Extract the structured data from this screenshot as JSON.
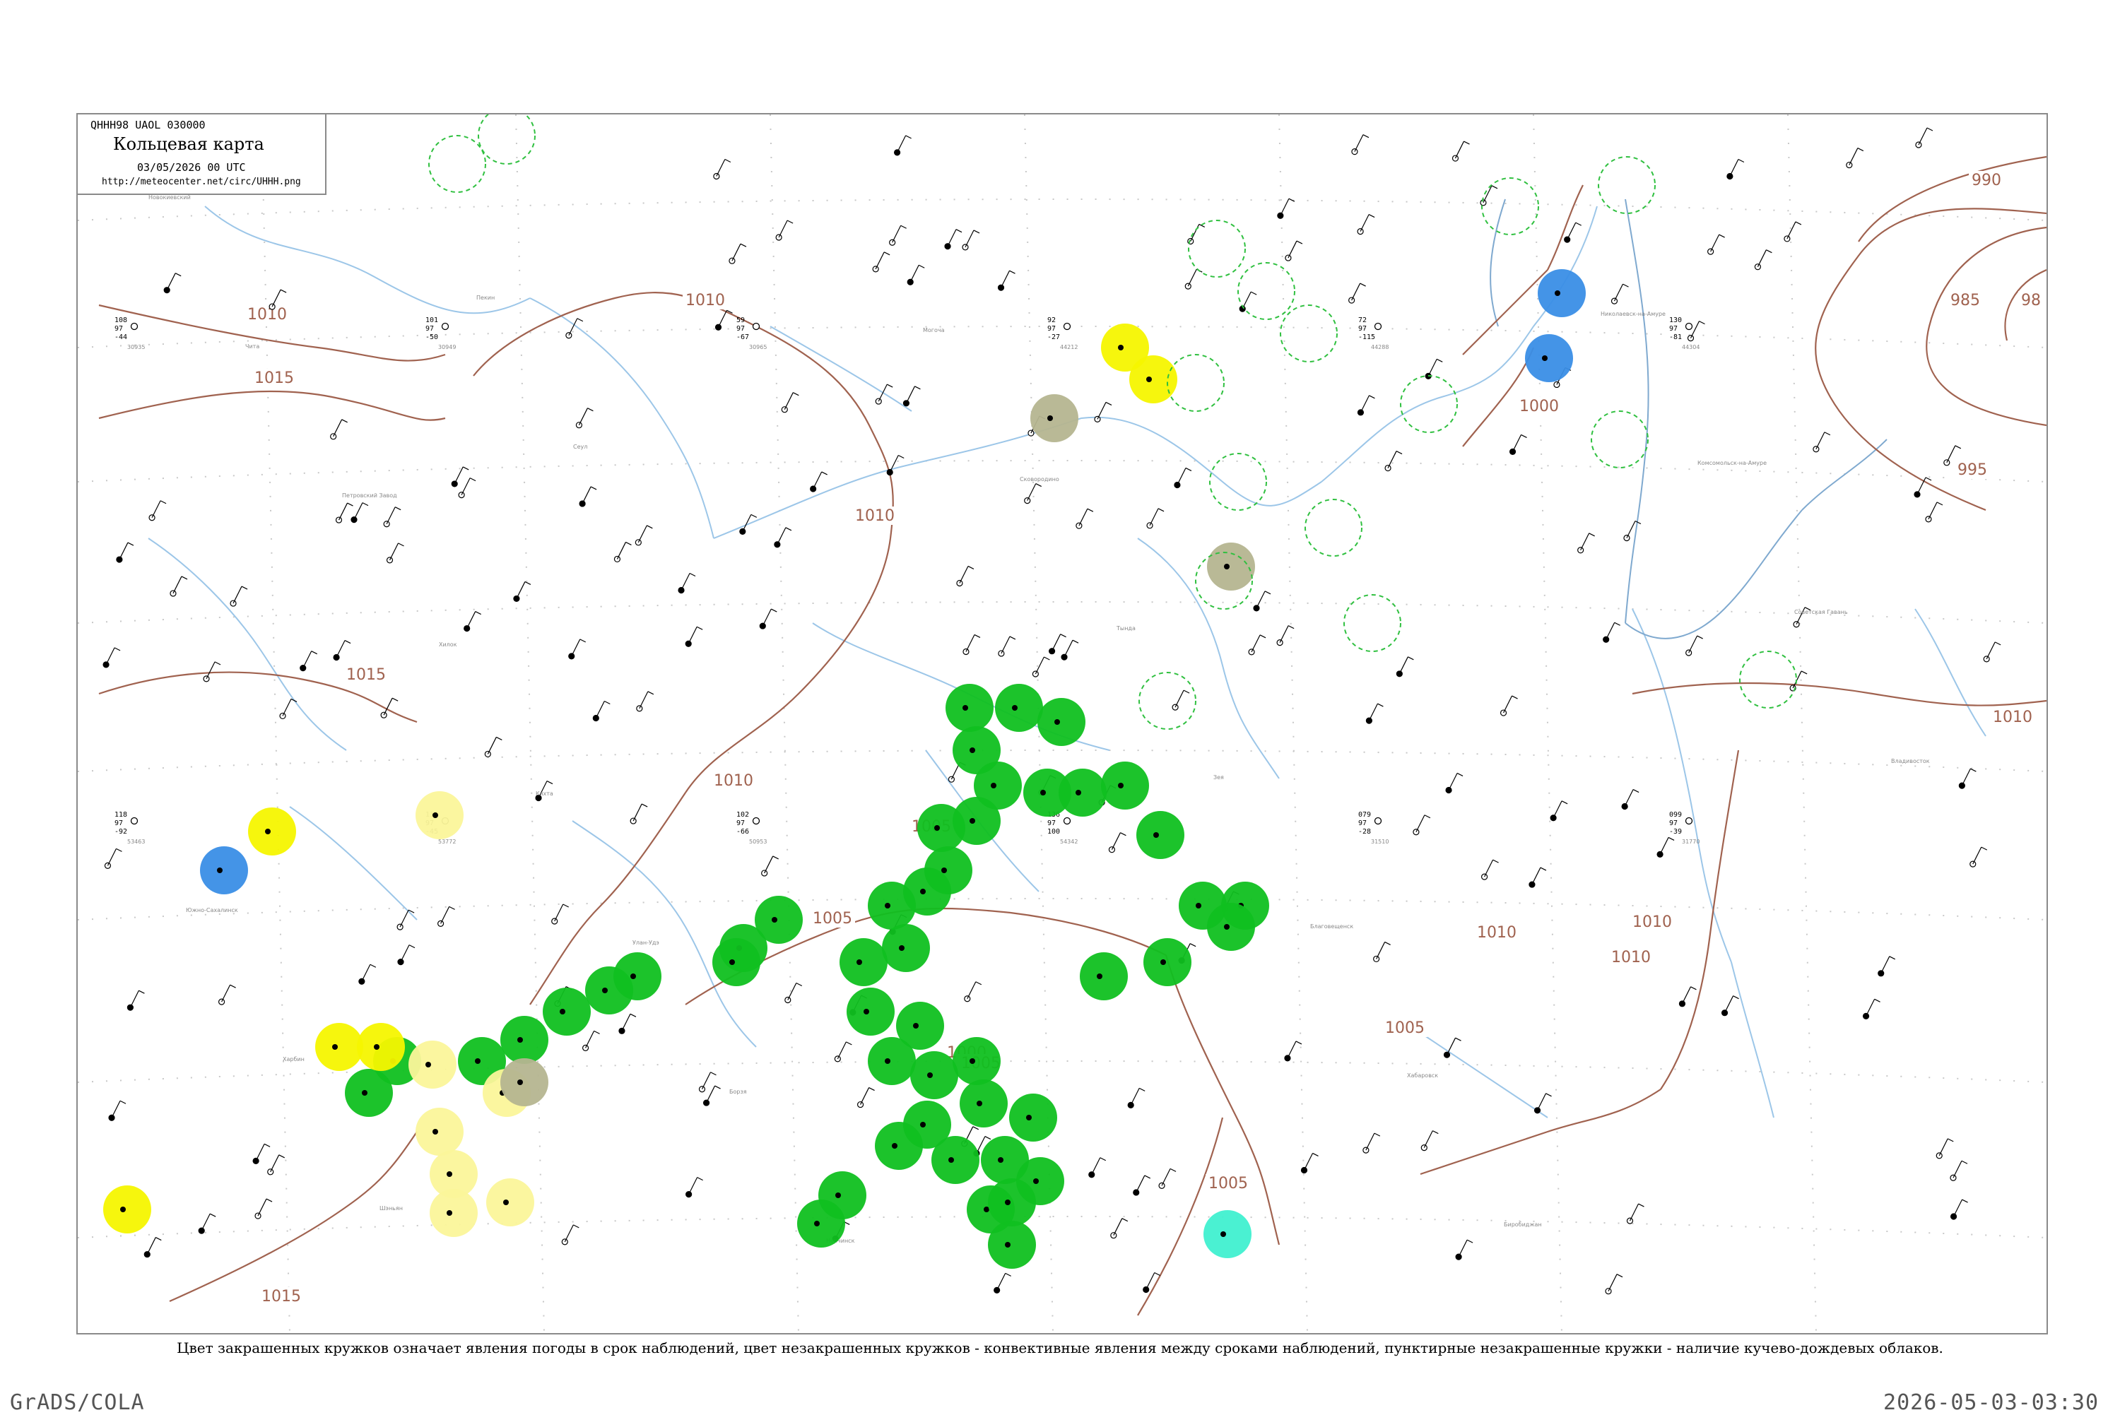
{
  "header": {
    "bulletin_code": "QHHH98  UAOL  030000",
    "title": "Кольцевая карта",
    "datetime": "03/05/2026 00 UTC",
    "url": "http://meteocenter.net/circ/UHHH.png"
  },
  "caption": "Цвет закрашенных кружков означает явления погоды в срок наблюдений, цвет незакрашенных кружков - конвективные явления между сроками наблюдений, пунктирные незакрашенные кружки - наличие кучево-дождевых облаков.",
  "footer": {
    "left": "GrADS/COLA",
    "right": "2026-05-03-03:30"
  },
  "colors": {
    "isobar": "#a0624f",
    "river": "#9cc6e8",
    "grid": "#c8c8c8",
    "rain": "#10c020",
    "drizzle": "#f5f500",
    "light_drizzle": "#fbf59a",
    "mist": "#b5b590",
    "snow": "#3a8ee6",
    "fog_cyan": "#40f0d0",
    "cb_outline": "#30c040"
  },
  "isobars": [
    {
      "label": "1010"
    },
    {
      "label": "1015"
    },
    {
      "label": "1015"
    },
    {
      "label": "1010"
    },
    {
      "label": "1010"
    },
    {
      "label": "1010"
    },
    {
      "label": "1005"
    },
    {
      "label": "1005"
    },
    {
      "label": "1000"
    },
    {
      "label": "1010"
    },
    {
      "label": "1005"
    },
    {
      "label": "1010"
    },
    {
      "label": "1015"
    },
    {
      "label": "1010"
    },
    {
      "label": "1005"
    },
    {
      "label": "1000"
    },
    {
      "label": "995"
    },
    {
      "label": "990"
    },
    {
      "label": "985"
    },
    {
      "label": "98"
    },
    {
      "label": "1010"
    },
    {
      "label": "1005"
    }
  ],
  "map_labels": [
    "Новокиевский",
    "Чита",
    "Петровский Завод",
    "Хилок",
    "Кяхта",
    "Улан-Удэ",
    "Борзя",
    "Нерчинск",
    "Могоча",
    "Сковородино",
    "Тында",
    "Зея",
    "Благовещенск",
    "Хабаровск",
    "Биробиджан",
    "Николаевск-на-Амуре",
    "Комсомольск-на-Амуре",
    "Советская Гавань",
    "Владивосток",
    "Южно-Сахалинск",
    "Харбин",
    "Шэньян",
    "Пекин",
    "Сеул"
  ],
  "stations": [
    {
      "id": "30935",
      "p": "108",
      "t": "97",
      "d": "-44"
    },
    {
      "id": "30949",
      "p": "101",
      "t": "97",
      "d": "-50"
    },
    {
      "id": "30965",
      "p": "59",
      "t": "97",
      "d": "-67"
    },
    {
      "id": "44212",
      "p": "92",
      "t": "97",
      "d": "-27"
    },
    {
      "id": "44288",
      "p": "72",
      "t": "97",
      "d": "-115"
    },
    {
      "id": "44304",
      "p": "130",
      "t": "97",
      "d": "-81"
    },
    {
      "id": "53463",
      "p": "118",
      "t": "97",
      "d": "-92"
    },
    {
      "id": "53772",
      "p": "115",
      "t": "97",
      "d": "-45"
    },
    {
      "id": "50953",
      "p": "102",
      "t": "97",
      "d": "-66"
    },
    {
      "id": "54342",
      "p": "136",
      "t": "97",
      "d": "100"
    },
    {
      "id": "31510",
      "p": "079",
      "t": "97",
      "d": "-28"
    },
    {
      "id": "31770",
      "p": "099",
      "t": "97",
      "d": "-39"
    }
  ],
  "weather_dots": [
    {
      "kind": "rain",
      "count": 48
    },
    {
      "kind": "drizzle",
      "count": 6
    },
    {
      "kind": "light_drizzle",
      "count": 7
    },
    {
      "kind": "mist",
      "count": 3
    },
    {
      "kind": "snow",
      "count": 3
    },
    {
      "kind": "fog_cyan",
      "count": 1
    }
  ]
}
